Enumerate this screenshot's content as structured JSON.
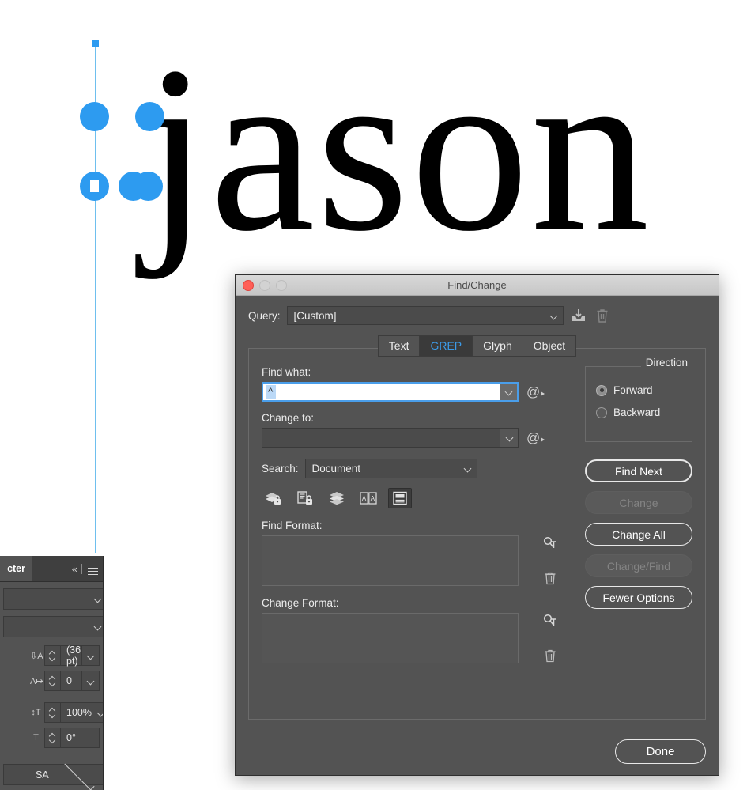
{
  "canvas": {
    "text": "jason",
    "selection_color": "#2D9BF0",
    "frame_color": "#6EBFEE"
  },
  "character_panel": {
    "tab_label": "cter",
    "collapse_icon": "collapse-double-chevron-icon",
    "menu_icon": "panel-menu-icon",
    "font_family_value": "",
    "font_style_value": "",
    "leading_value": "(36 pt)",
    "kerning_value": "0",
    "tracking_value": "100%",
    "skew_value": "0°",
    "language_value": "SA"
  },
  "dialog": {
    "title": "Find/Change",
    "traffic_lights": [
      "close-button",
      "minimize-button",
      "maximize-button"
    ],
    "query": {
      "label": "Query:",
      "value": "[Custom]",
      "save_icon": "save-query-icon",
      "delete_icon": "delete-query-icon"
    },
    "tabs": [
      {
        "label": "Text",
        "active": false
      },
      {
        "label": "GREP",
        "active": true
      },
      {
        "label": "Glyph",
        "active": false
      },
      {
        "label": "Object",
        "active": false
      }
    ],
    "tab_active_color": "#3C9BE8",
    "find_what": {
      "label": "Find what:",
      "value": "^",
      "special_chars_icon": "at-menu-icon"
    },
    "change_to": {
      "label": "Change to:",
      "value": "",
      "special_chars_icon": "at-menu-icon"
    },
    "search": {
      "label": "Search:",
      "value": "Document"
    },
    "scope_icons": [
      {
        "name": "include-locked-layers-icon",
        "active": false
      },
      {
        "name": "include-locked-stories-icon",
        "active": false
      },
      {
        "name": "include-hidden-layers-icon",
        "active": false
      },
      {
        "name": "include-master-pages-icon",
        "active": false
      },
      {
        "name": "include-footnotes-icon",
        "active": true
      }
    ],
    "find_format": {
      "label": "Find Format:",
      "value": "",
      "specify_icon": "specify-attributes-icon",
      "clear_icon": "clear-format-icon"
    },
    "change_format": {
      "label": "Change Format:",
      "value": "",
      "specify_icon": "specify-attributes-icon",
      "clear_icon": "clear-format-icon"
    },
    "direction": {
      "title": "Direction",
      "options": [
        {
          "label": "Forward",
          "selected": true
        },
        {
          "label": "Backward",
          "selected": false
        }
      ]
    },
    "buttons": [
      {
        "label": "Find Next",
        "enabled": true,
        "default": true
      },
      {
        "label": "Change",
        "enabled": false,
        "default": false
      },
      {
        "label": "Change All",
        "enabled": true,
        "default": false
      },
      {
        "label": "Change/Find",
        "enabled": false,
        "default": false
      },
      {
        "label": "Fewer Options",
        "enabled": true,
        "default": false
      }
    ],
    "done_label": "Done"
  }
}
